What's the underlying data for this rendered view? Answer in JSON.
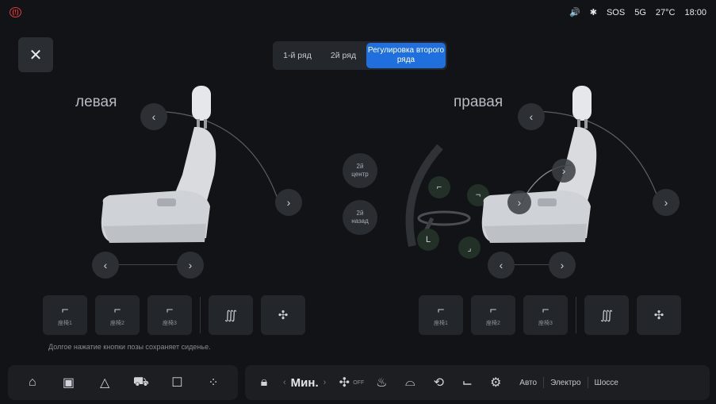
{
  "status": {
    "alert_icon": "alert-icon",
    "volume": "🔊",
    "bluetooth": "✱",
    "sos": "SOS",
    "network": "5G",
    "temperature": "27°C",
    "time": "18:00"
  },
  "header": {
    "close": "✕",
    "tabs": [
      "1-й ряд",
      "2й ряд",
      "Регулировка второго ряда"
    ],
    "active_tab": 2
  },
  "left_side": {
    "label": "левая"
  },
  "right_side": {
    "label": "правая"
  },
  "center": {
    "btn_center": [
      "2й",
      "центр"
    ],
    "btn_back": [
      "2й",
      "назад"
    ]
  },
  "controls": {
    "left": "‹",
    "right": "›",
    "recline_up": "‹",
    "recline_down": "›"
  },
  "memory": {
    "left": [
      "座椅1",
      "座椅2",
      "座椅3"
    ],
    "right": [
      "座椅1",
      "座椅2",
      "座椅3"
    ],
    "heat": "∭",
    "vent": "✣"
  },
  "hint": "Долгое нажатие кнопки позы сохраняет сиденье.",
  "dock": {
    "temperature": "Мин.",
    "fan_off": "OFF",
    "modes": [
      "Авто",
      "Электро",
      "Шоссе"
    ]
  },
  "colors": {
    "accent": "#1f6fdf",
    "alert": "#e23b3b",
    "background": "#111316"
  }
}
